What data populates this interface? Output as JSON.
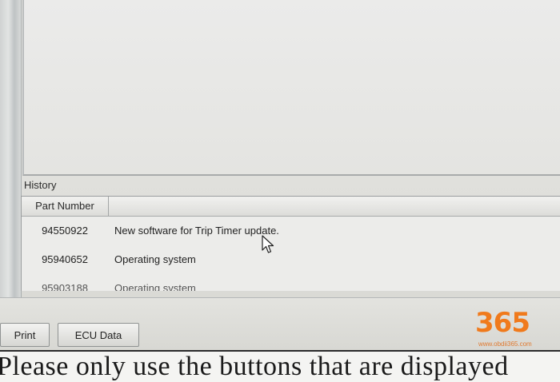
{
  "history": {
    "label": "History",
    "columns": [
      "Part Number",
      ""
    ],
    "rows": [
      {
        "part": "94550922",
        "description": "New software for Trip Timer update."
      },
      {
        "part": "95940652",
        "description": "Operating system"
      },
      {
        "part": "95903188",
        "description": "Operating system"
      }
    ]
  },
  "buttons": {
    "print": "Print",
    "ecu_data": "ECU Data"
  },
  "instruction": "Please only use the buttons that are displayed",
  "watermark": {
    "digits": "365",
    "url": "www.obdii365.com"
  }
}
